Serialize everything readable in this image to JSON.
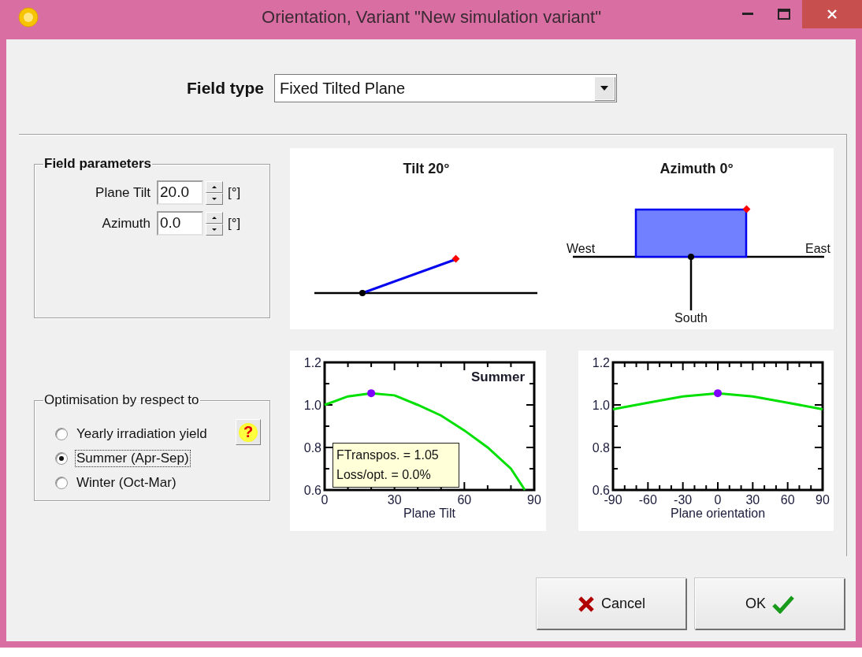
{
  "window": {
    "title": "Orientation, Variant \"New simulation variant\""
  },
  "field_type": {
    "label": "Field type",
    "value": "Fixed Tilted Plane"
  },
  "field_parameters": {
    "title": "Field parameters",
    "rows": [
      {
        "label": "Plane Tilt",
        "value": "20.0",
        "unit": "[°]"
      },
      {
        "label": "Azimuth",
        "value": "0.0",
        "unit": "[°]"
      }
    ]
  },
  "optimisation": {
    "title": "Optimisation by respect to",
    "help_button": "?",
    "options": [
      {
        "label": "Yearly irradiation yield",
        "selected": false
      },
      {
        "label": "Summer (Apr-Sep)",
        "selected": true
      },
      {
        "label": "Winter (Oct-Mar)",
        "selected": false
      }
    ]
  },
  "tilt_sketch": {
    "title": "Tilt 20°"
  },
  "azimuth_sketch": {
    "title": "Azimuth 0°",
    "west": "West",
    "east": "East",
    "south": "South"
  },
  "tilt_chart": {
    "info": [
      "FTranspos. = 1.05",
      "Loss/opt. = 0.0%"
    ],
    "chart_data": {
      "type": "line",
      "xlabel": "Plane Tilt",
      "x": [
        0,
        10,
        20,
        30,
        40,
        50,
        60,
        70,
        80,
        86
      ],
      "series": [
        {
          "name": "Summer",
          "color": "#00e000",
          "values": [
            1.0,
            1.04,
            1.055,
            1.045,
            1.0,
            0.95,
            0.88,
            0.8,
            0.7,
            0.6
          ]
        }
      ],
      "xlim": [
        0,
        90
      ],
      "ylim": [
        0.6,
        1.2
      ],
      "xticks": [
        0,
        30,
        60,
        90
      ],
      "yticks": [
        {
          "value": 0.6,
          "label": "0.6"
        },
        {
          "value": 0.8,
          "label": "0.8"
        },
        {
          "value": 1.0,
          "label": "1.0"
        },
        {
          "value": 1.2,
          "label": "1.2"
        }
      ]
    }
  },
  "orientation_chart": {
    "chart_data": {
      "type": "line",
      "xlabel": "Plane orientation",
      "x": [
        -90,
        -60,
        -30,
        0,
        30,
        60,
        90
      ],
      "series": [
        {
          "color": "#00e000",
          "values": [
            0.98,
            1.01,
            1.04,
            1.055,
            1.04,
            1.01,
            0.98
          ]
        }
      ],
      "xlim": [
        -90,
        90
      ],
      "ylim": [
        0.6,
        1.2
      ],
      "xticks": [
        -90,
        -60,
        -30,
        0,
        30,
        60,
        90
      ],
      "yticks": [
        {
          "value": 0.6,
          "label": "0.6"
        },
        {
          "value": 0.8,
          "label": "0.8"
        },
        {
          "value": 1.0,
          "label": "1.0"
        },
        {
          "value": 1.2,
          "label": "1.2"
        }
      ]
    }
  },
  "buttons": [
    {
      "kind": "cancel",
      "label": "Cancel"
    },
    {
      "kind": "ok",
      "label": "OK"
    }
  ]
}
